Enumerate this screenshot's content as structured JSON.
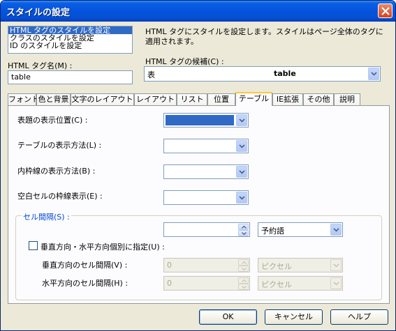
{
  "window": {
    "title": "スタイルの設定"
  },
  "style_list": {
    "items": [
      {
        "label": "HTML タグのスタイルを設定",
        "selected": true
      },
      {
        "label": "クラスのスタイルを設定",
        "selected": false
      },
      {
        "label": "ID のスタイルを設定",
        "selected": false
      }
    ]
  },
  "help_text": "HTML タグにスタイルを設定します。スタイルはページ全体のタグに適用されます。",
  "tag_name": {
    "label": "HTML タグ名(M) :",
    "value": "table"
  },
  "tag_candidates": {
    "label": "HTML タグの候補(C) :",
    "value_left": "表",
    "value_right": "table"
  },
  "tabs": [
    {
      "label": "フォント",
      "active": false
    },
    {
      "label": "色と背景",
      "active": false
    },
    {
      "label": "文字のレイアウト",
      "active": false
    },
    {
      "label": "レイアウト",
      "active": false
    },
    {
      "label": "リスト",
      "active": false
    },
    {
      "label": "位置",
      "active": false
    },
    {
      "label": "テーブル",
      "active": true
    },
    {
      "label": "IE拡張",
      "active": false
    },
    {
      "label": "その他",
      "active": false
    },
    {
      "label": "説明",
      "active": false
    }
  ],
  "table_tab": {
    "caption_position": {
      "label": "表題の表示位置(C) :",
      "value": ""
    },
    "table_layout": {
      "label": "テーブルの表示方法(L) :",
      "value": ""
    },
    "border_collapse": {
      "label": "内枠線の表示方法(B) :",
      "value": ""
    },
    "empty_cells": {
      "label": "空白セルの枠線表示(E) :",
      "value": ""
    },
    "cell_spacing": {
      "legend": "セル間隔(S) :",
      "value": "",
      "unit": "予約語",
      "separate_checkbox": {
        "label": "垂直方向・水平方向個別に指定(U) :",
        "checked": false
      },
      "vertical": {
        "label": "垂直方向のセル間隔(V) :",
        "value": "0",
        "unit": "ピクセル"
      },
      "horizontal": {
        "label": "水平方向のセル間隔(H) :",
        "value": "0",
        "unit": "ピクセル"
      }
    }
  },
  "buttons": {
    "ok": "OK",
    "cancel": "キャンセル",
    "help": "ヘルプ"
  },
  "colors": {
    "title_bar": "#0553dc",
    "selection": "#316ac5",
    "active_tab_accent": "#ffc83c"
  }
}
